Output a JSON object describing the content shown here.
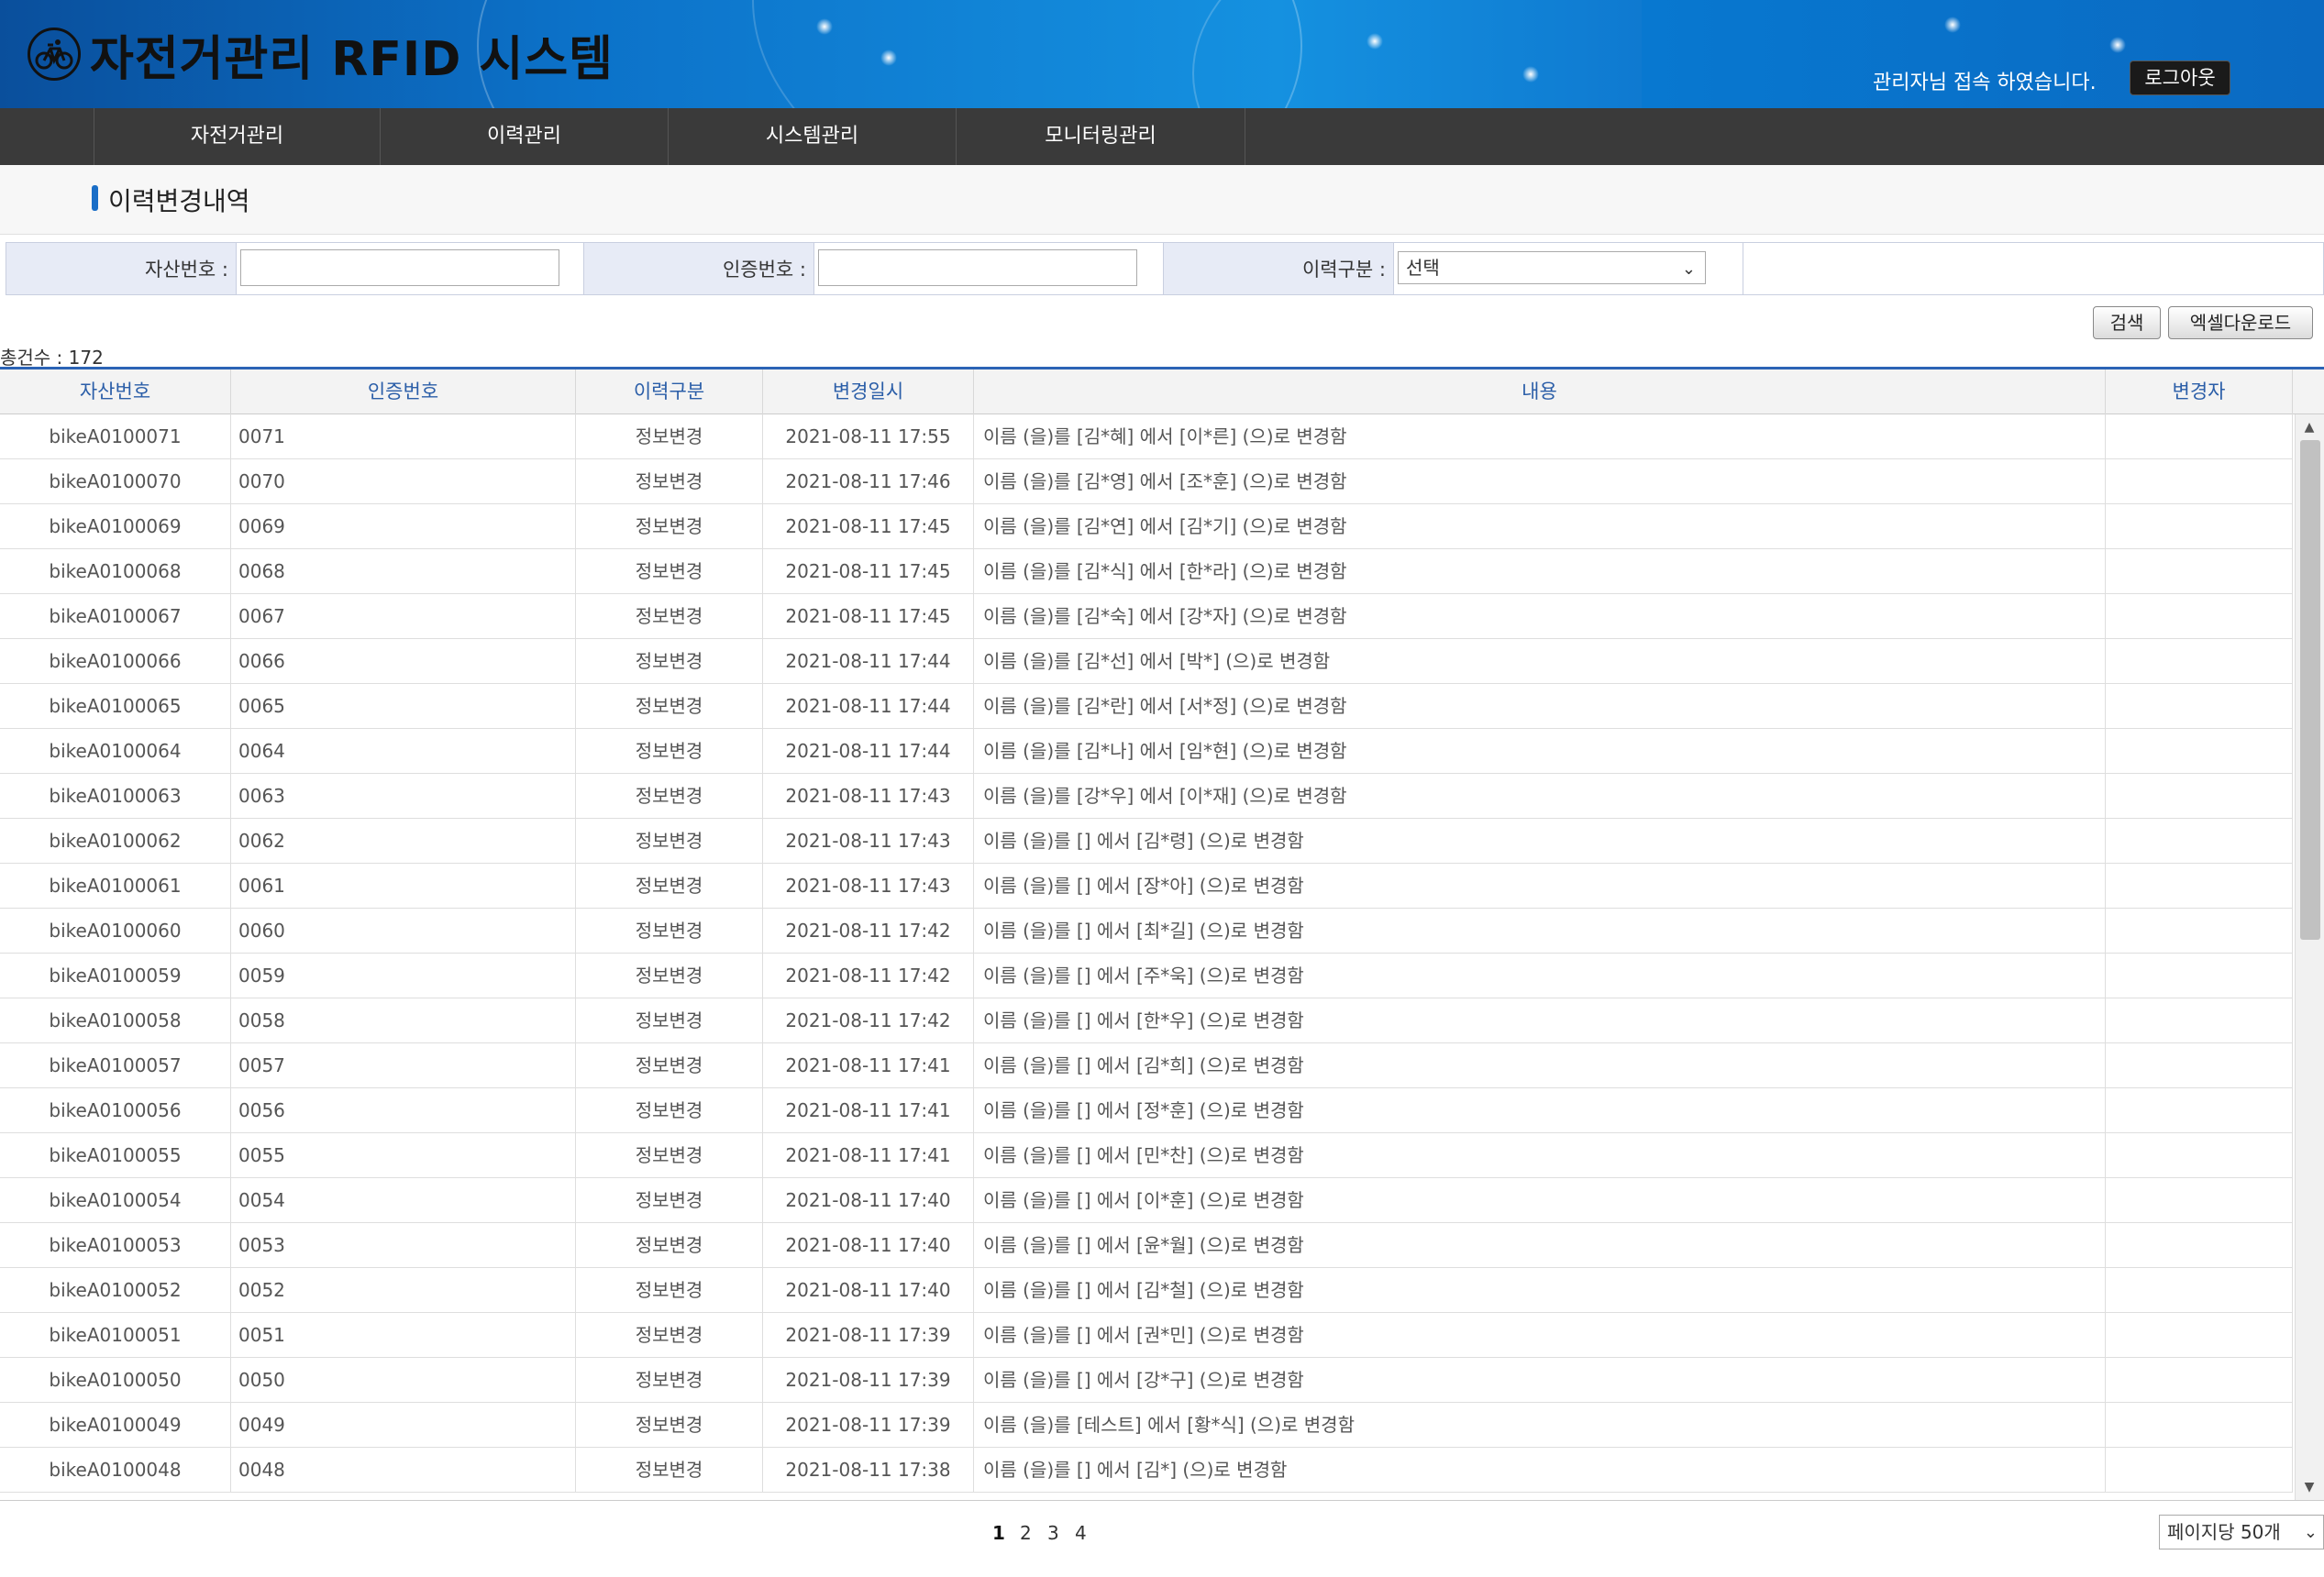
{
  "header": {
    "app_title": "자전거관리 RFID 시스템",
    "login_message": "관리자님 접속 하였습니다.",
    "logout_label": "로그아웃"
  },
  "nav": {
    "items": [
      {
        "label": "자전거관리"
      },
      {
        "label": "이력관리"
      },
      {
        "label": "시스템관리"
      },
      {
        "label": "모니터링관리"
      }
    ]
  },
  "page_title": "이력변경내역",
  "search": {
    "asset_label": "자산번호 :",
    "asset_value": "",
    "auth_label": "인증번호 :",
    "auth_value": "",
    "type_label": "이력구분 :",
    "type_selected": "선택"
  },
  "buttons": {
    "search_label": "검색",
    "excel_label": "엑셀다운로드"
  },
  "total_count": "총건수 : 172",
  "table": {
    "headers": {
      "asset": "자산번호",
      "auth": "인증번호",
      "type": "이력구분",
      "date": "변경일시",
      "content": "내용",
      "editor": "변경자"
    },
    "rows": [
      {
        "asset": "bikeA0100071",
        "auth": "0071",
        "type": "정보변경",
        "date": "2021-08-11 17:55",
        "content": "이름 (을)를 [김*혜] 에서 [이*른] (으)로 변경함",
        "editor": ""
      },
      {
        "asset": "bikeA0100070",
        "auth": "0070",
        "type": "정보변경",
        "date": "2021-08-11 17:46",
        "content": "이름 (을)를 [김*영] 에서 [조*훈] (으)로 변경함",
        "editor": ""
      },
      {
        "asset": "bikeA0100069",
        "auth": "0069",
        "type": "정보변경",
        "date": "2021-08-11 17:45",
        "content": "이름 (을)를 [김*연] 에서 [김*기] (으)로 변경함",
        "editor": ""
      },
      {
        "asset": "bikeA0100068",
        "auth": "0068",
        "type": "정보변경",
        "date": "2021-08-11 17:45",
        "content": "이름 (을)를 [김*식] 에서 [한*라] (으)로 변경함",
        "editor": ""
      },
      {
        "asset": "bikeA0100067",
        "auth": "0067",
        "type": "정보변경",
        "date": "2021-08-11 17:45",
        "content": "이름 (을)를 [김*숙] 에서 [강*자] (으)로 변경함",
        "editor": ""
      },
      {
        "asset": "bikeA0100066",
        "auth": "0066",
        "type": "정보변경",
        "date": "2021-08-11 17:44",
        "content": "이름 (을)를 [김*선] 에서 [박*] (으)로 변경함",
        "editor": ""
      },
      {
        "asset": "bikeA0100065",
        "auth": "0065",
        "type": "정보변경",
        "date": "2021-08-11 17:44",
        "content": "이름 (을)를 [김*란] 에서 [서*정] (으)로 변경함",
        "editor": ""
      },
      {
        "asset": "bikeA0100064",
        "auth": "0064",
        "type": "정보변경",
        "date": "2021-08-11 17:44",
        "content": "이름 (을)를 [김*나] 에서 [임*현] (으)로 변경함",
        "editor": ""
      },
      {
        "asset": "bikeA0100063",
        "auth": "0063",
        "type": "정보변경",
        "date": "2021-08-11 17:43",
        "content": "이름 (을)를 [강*우] 에서 [이*재] (으)로 변경함",
        "editor": ""
      },
      {
        "asset": "bikeA0100062",
        "auth": "0062",
        "type": "정보변경",
        "date": "2021-08-11 17:43",
        "content": "이름 (을)를 [] 에서 [김*령] (으)로 변경함",
        "editor": ""
      },
      {
        "asset": "bikeA0100061",
        "auth": "0061",
        "type": "정보변경",
        "date": "2021-08-11 17:43",
        "content": "이름 (을)를 [] 에서 [장*아] (으)로 변경함",
        "editor": ""
      },
      {
        "asset": "bikeA0100060",
        "auth": "0060",
        "type": "정보변경",
        "date": "2021-08-11 17:42",
        "content": "이름 (을)를 [] 에서 [최*길] (으)로 변경함",
        "editor": ""
      },
      {
        "asset": "bikeA0100059",
        "auth": "0059",
        "type": "정보변경",
        "date": "2021-08-11 17:42",
        "content": "이름 (을)를 [] 에서 [주*욱] (으)로 변경함",
        "editor": ""
      },
      {
        "asset": "bikeA0100058",
        "auth": "0058",
        "type": "정보변경",
        "date": "2021-08-11 17:42",
        "content": "이름 (을)를 [] 에서 [한*우] (으)로 변경함",
        "editor": ""
      },
      {
        "asset": "bikeA0100057",
        "auth": "0057",
        "type": "정보변경",
        "date": "2021-08-11 17:41",
        "content": "이름 (을)를 [] 에서 [김*희] (으)로 변경함",
        "editor": ""
      },
      {
        "asset": "bikeA0100056",
        "auth": "0056",
        "type": "정보변경",
        "date": "2021-08-11 17:41",
        "content": "이름 (을)를 [] 에서 [정*훈] (으)로 변경함",
        "editor": ""
      },
      {
        "asset": "bikeA0100055",
        "auth": "0055",
        "type": "정보변경",
        "date": "2021-08-11 17:41",
        "content": "이름 (을)를 [] 에서 [민*찬] (으)로 변경함",
        "editor": ""
      },
      {
        "asset": "bikeA0100054",
        "auth": "0054",
        "type": "정보변경",
        "date": "2021-08-11 17:40",
        "content": "이름 (을)를 [] 에서 [이*훈] (으)로 변경함",
        "editor": ""
      },
      {
        "asset": "bikeA0100053",
        "auth": "0053",
        "type": "정보변경",
        "date": "2021-08-11 17:40",
        "content": "이름 (을)를 [] 에서 [윤*월] (으)로 변경함",
        "editor": ""
      },
      {
        "asset": "bikeA0100052",
        "auth": "0052",
        "type": "정보변경",
        "date": "2021-08-11 17:40",
        "content": "이름 (을)를 [] 에서 [김*철] (으)로 변경함",
        "editor": ""
      },
      {
        "asset": "bikeA0100051",
        "auth": "0051",
        "type": "정보변경",
        "date": "2021-08-11 17:39",
        "content": "이름 (을)를 [] 에서 [권*민] (으)로 변경함",
        "editor": ""
      },
      {
        "asset": "bikeA0100050",
        "auth": "0050",
        "type": "정보변경",
        "date": "2021-08-11 17:39",
        "content": "이름 (을)를 [] 에서 [강*구] (으)로 변경함",
        "editor": ""
      },
      {
        "asset": "bikeA0100049",
        "auth": "0049",
        "type": "정보변경",
        "date": "2021-08-11 17:39",
        "content": "이름 (을)를 [테스트] 에서 [황*식] (으)로 변경함",
        "editor": ""
      },
      {
        "asset": "bikeA0100048",
        "auth": "0048",
        "type": "정보변경",
        "date": "2021-08-11 17:38",
        "content": "이름 (을)를 [] 에서 [김*] (으)로 변경함",
        "editor": ""
      }
    ]
  },
  "pagination": {
    "pages": [
      "1",
      "2",
      "3",
      "4"
    ],
    "current": "1",
    "per_page_label": "페이지당 50개"
  }
}
